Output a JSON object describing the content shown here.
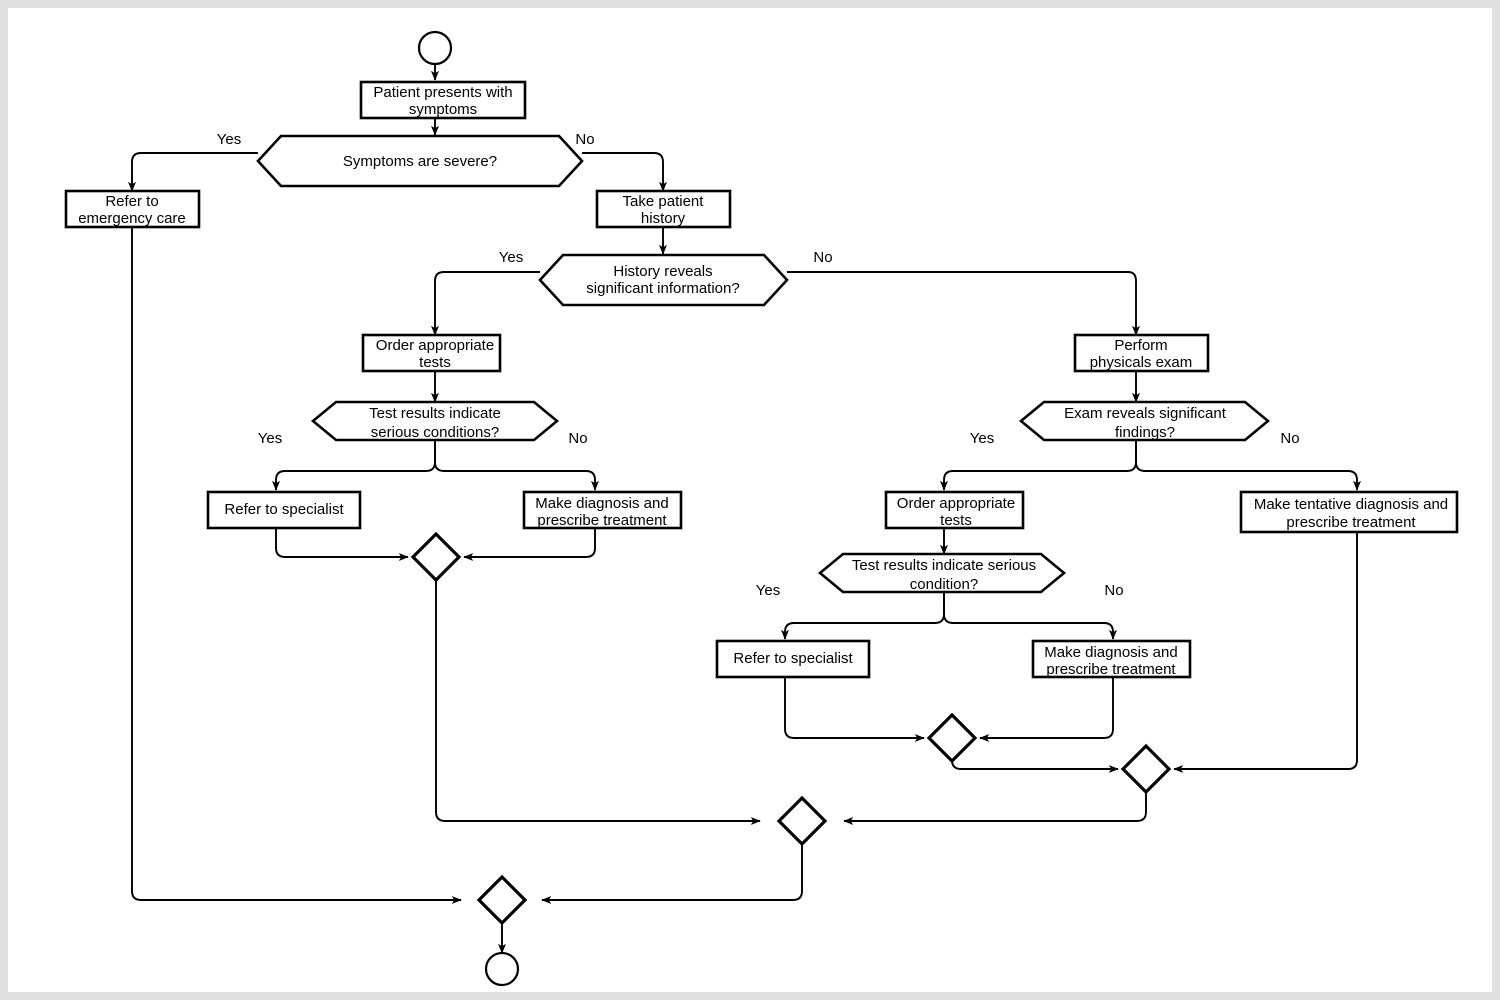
{
  "diagram": {
    "title": "Clinical triage and diagnosis flowchart",
    "background_color": "#e0e0e0",
    "canvas_color": "#ffffff",
    "line_color": "#000000",
    "nodes": {
      "start": {
        "type": "start-terminal",
        "label": ""
      },
      "n_symptoms": {
        "type": "process",
        "line1": "Patient presents with",
        "line2": "symptoms"
      },
      "d_severe": {
        "type": "decision",
        "line1": "Symptoms are severe?",
        "line2": ""
      },
      "n_emergency": {
        "type": "process",
        "line1": "Refer to",
        "line2": "emergency care"
      },
      "n_history": {
        "type": "process",
        "line1": "Take patient",
        "line2": "history"
      },
      "d_history": {
        "type": "decision",
        "line1": "History reveals",
        "line2": "significant information?"
      },
      "n_tests_left": {
        "type": "process",
        "line1": "Order appropriate",
        "line2": "tests"
      },
      "d_tests_left": {
        "type": "decision",
        "line1": "Test results indicate",
        "line2": "serious conditions?"
      },
      "n_specialist_left": {
        "type": "process",
        "line1": "Refer to specialist",
        "line2": ""
      },
      "n_diagnosis_left": {
        "type": "process",
        "line1": "Make diagnosis and",
        "line2": "prescribe treatment"
      },
      "n_physical": {
        "type": "process",
        "line1": "Perform",
        "line2": "physicals exam"
      },
      "d_exam": {
        "type": "decision",
        "line1": "Exam reveals significant",
        "line2": "findings?"
      },
      "n_tests_right": {
        "type": "process",
        "line1": "Order appropriate",
        "line2": "tests"
      },
      "n_tentative": {
        "type": "process",
        "line1": "Make tentative diagnosis and",
        "line2": "prescribe treatment"
      },
      "d_tests_right": {
        "type": "decision",
        "line1": "Test results indicate serious",
        "line2": "condition?"
      },
      "n_specialist_right": {
        "type": "process",
        "line1": "Refer to specialist",
        "line2": ""
      },
      "n_diagnosis_right": {
        "type": "process",
        "line1": "Make diagnosis and",
        "line2": "prescribe treatment"
      },
      "merge_left": {
        "type": "merge",
        "label": ""
      },
      "merge_inner_right": {
        "type": "merge",
        "label": ""
      },
      "merge_right": {
        "type": "merge",
        "label": ""
      },
      "merge_mid": {
        "type": "merge",
        "label": ""
      },
      "merge_final": {
        "type": "merge",
        "label": ""
      },
      "end": {
        "type": "end-terminal",
        "label": ""
      }
    },
    "edge_labels": {
      "severe_yes": "Yes",
      "severe_no": "No",
      "history_yes": "Yes",
      "history_no": "No",
      "tests_left_yes": "Yes",
      "tests_left_no": "No",
      "exam_yes": "Yes",
      "exam_no": "No",
      "tests_right_yes": "Yes",
      "tests_right_no": "No"
    }
  }
}
